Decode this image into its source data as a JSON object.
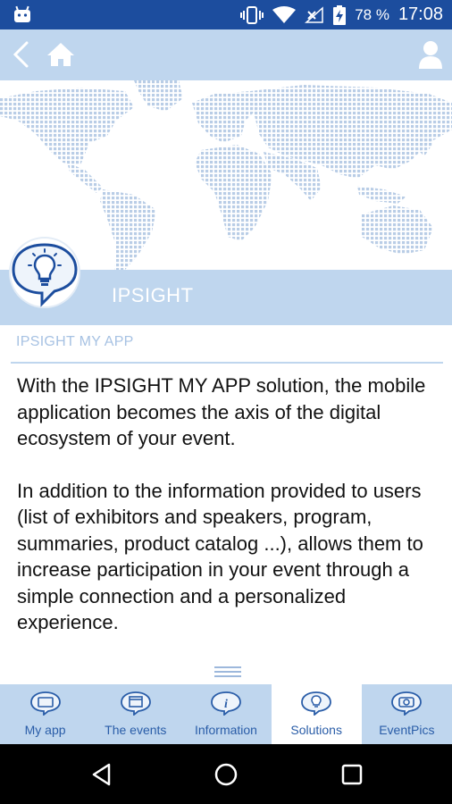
{
  "status_bar": {
    "battery_percent": "78 %",
    "time": "17:08",
    "icons": [
      "android-icon",
      "vibrate-icon",
      "wifi-icon",
      "signal-off-icon",
      "battery-charging-icon"
    ]
  },
  "app_bar": {
    "icons": [
      "back-icon",
      "home-icon",
      "user-icon"
    ]
  },
  "header": {
    "title": "IPSIGHT"
  },
  "content": {
    "subtitle": "IPSIGHT MY APP",
    "paragraphs": [
      "With the IPSIGHT MY APP solution, the mobile application becomes the axis of the digital ecosystem of your event.",
      "In addition to the information provided to users (list of exhibitors and speakers, program, summaries, product catalog ...), allows them to increase participation in your event through a simple connection and a personalized experience."
    ]
  },
  "tabs": [
    {
      "label": "My app",
      "icon": "tablet-bubble-icon",
      "active": false
    },
    {
      "label": "The events",
      "icon": "calendar-bubble-icon",
      "active": false
    },
    {
      "label": "Information",
      "icon": "info-bubble-icon",
      "active": false
    },
    {
      "label": "Solutions",
      "icon": "bulb-bubble-icon",
      "active": true
    },
    {
      "label": "EventPics",
      "icon": "camera-bubble-icon",
      "active": false
    }
  ],
  "colors": {
    "status_bar": "#1c4d9e",
    "light_blue": "#bfd6ee",
    "accent": "#2a5da8"
  }
}
